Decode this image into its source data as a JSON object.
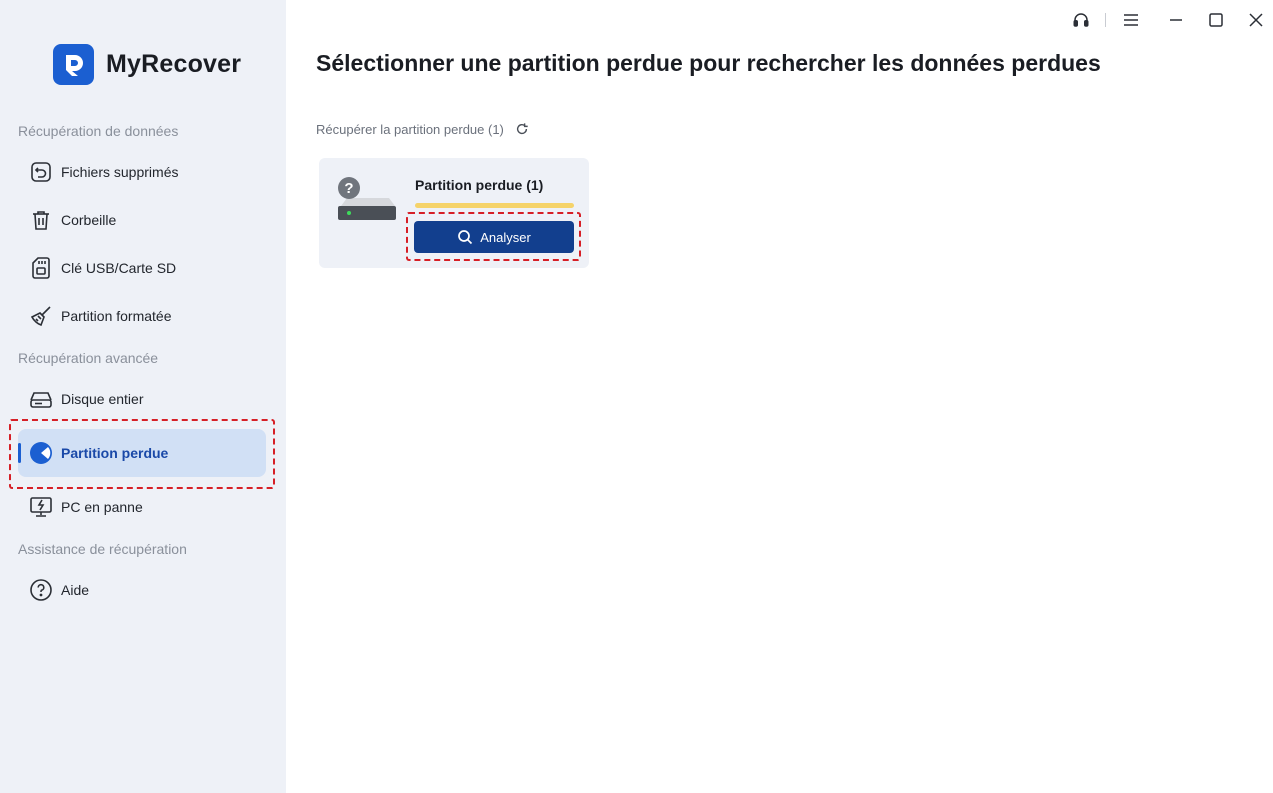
{
  "app": {
    "name": "MyRecover"
  },
  "sidebar": {
    "sections": [
      {
        "label": "Récupération de données"
      },
      {
        "label": "Récupération avancée"
      },
      {
        "label": "Assistance de récupération"
      }
    ],
    "items": [
      {
        "label": "Fichiers supprimés",
        "icon": "restore-icon"
      },
      {
        "label": "Corbeille",
        "icon": "trash-icon"
      },
      {
        "label": "Clé USB/Carte SD",
        "icon": "sd-card-icon"
      },
      {
        "label": "Partition formatée",
        "icon": "broom-icon"
      },
      {
        "label": "Disque entier",
        "icon": "hard-drive-icon"
      },
      {
        "label": "Partition perdue",
        "icon": "pie-chart-icon",
        "active": true
      },
      {
        "label": "PC en panne",
        "icon": "broken-pc-icon"
      },
      {
        "label": "Aide",
        "icon": "help-icon"
      }
    ]
  },
  "main": {
    "title": "Sélectionner une partition perdue pour rechercher les données perdues",
    "subheader": "Récupérer la partition perdue (1)",
    "card": {
      "title": "Partition perdue (1)",
      "button_label": "Analyser"
    }
  },
  "colors": {
    "brand": "#1b5fd1",
    "button": "#123f8e",
    "active_bg": "#d1e0f5",
    "highlight": "#d61f26",
    "bar": "#f5d36a"
  }
}
